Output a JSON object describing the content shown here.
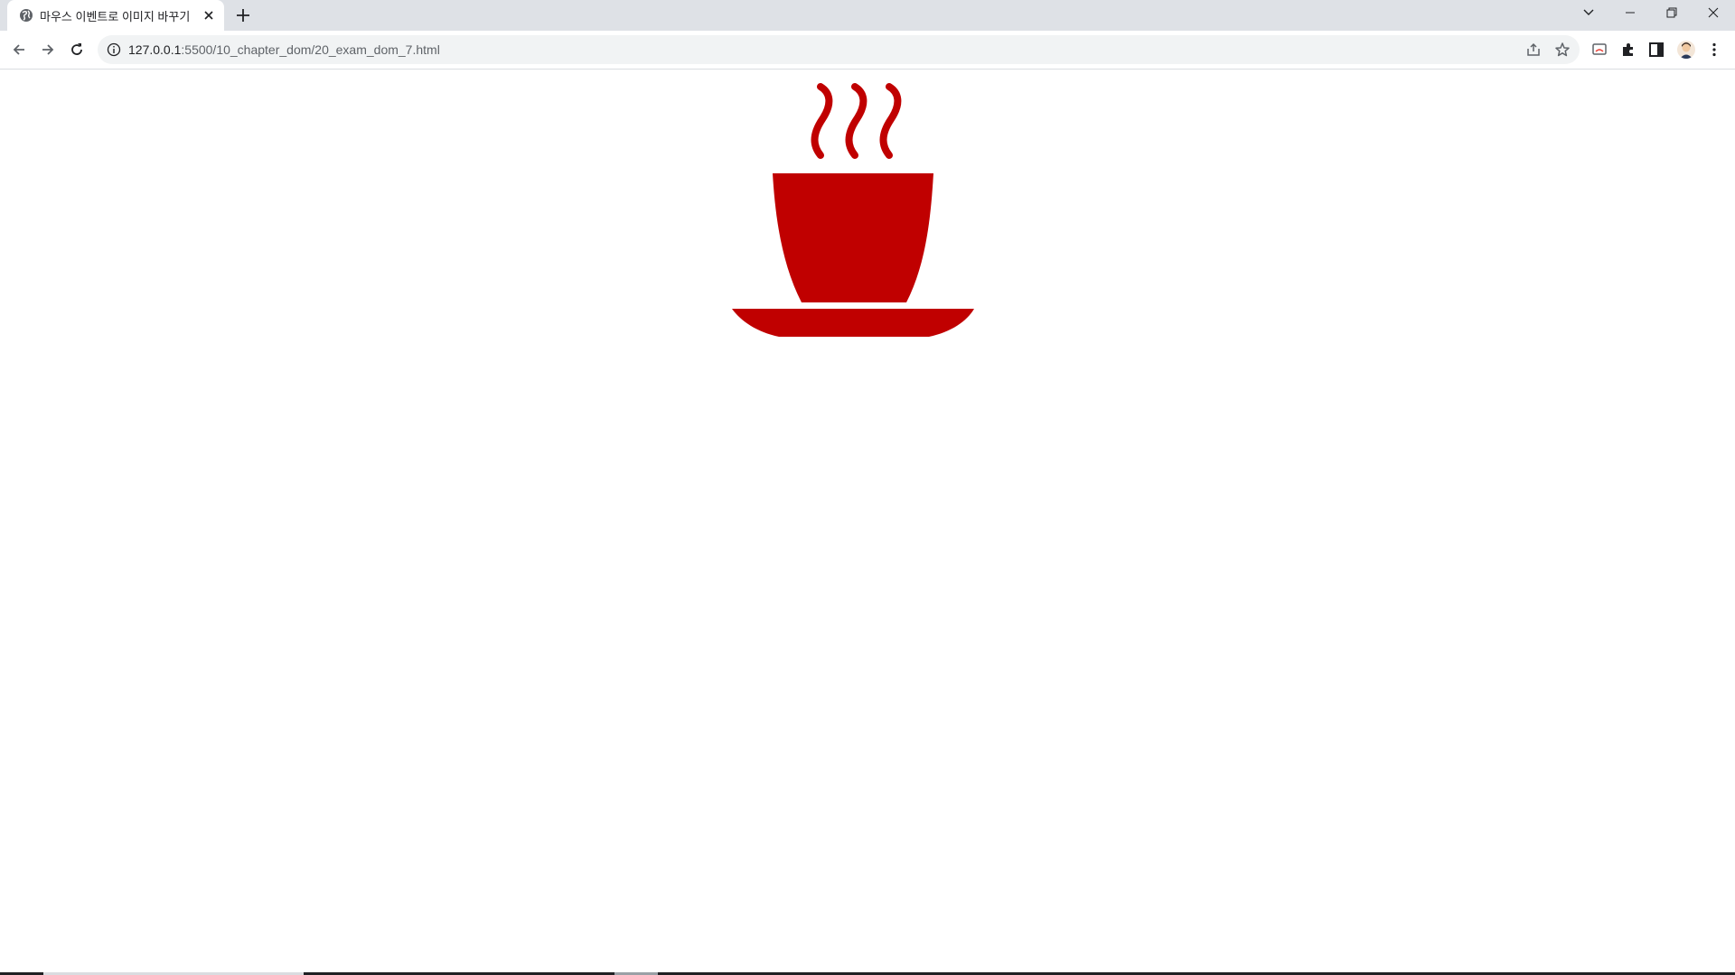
{
  "tab": {
    "title": "마우스 이벤트로 이미지 바꾸기",
    "favicon": "globe-icon"
  },
  "toolbar": {
    "url_host": "127.0.0.1",
    "url_path": ":5500/10_chapter_dom/20_exam_dom_7.html"
  },
  "page": {
    "image": {
      "subject": "red-coffee-cup-icon",
      "color": "#c00000"
    }
  },
  "colors": {
    "tabstrip_bg": "#dee1e6",
    "omnibox_bg": "#f1f3f4",
    "accent_red": "#c00000"
  }
}
